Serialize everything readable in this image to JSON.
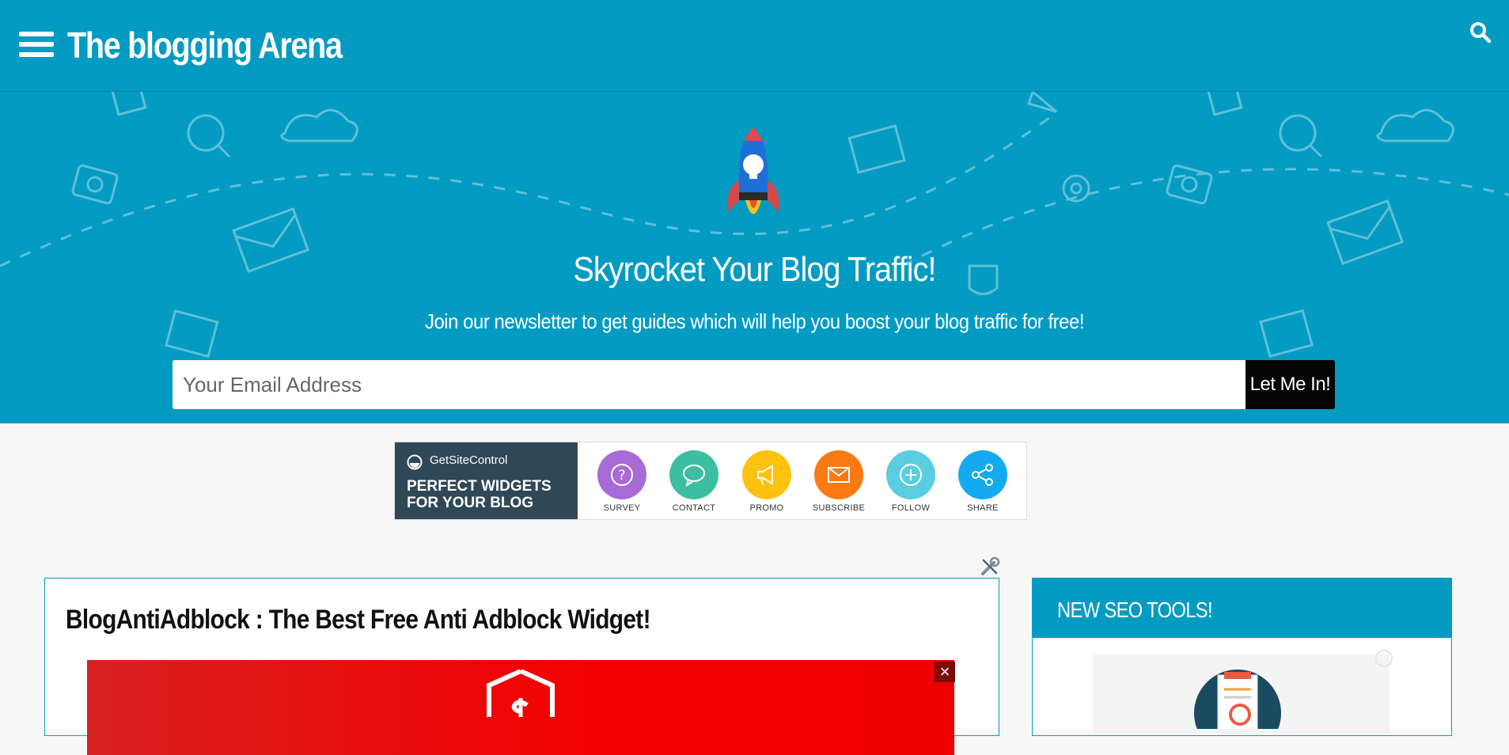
{
  "header": {
    "logo_text": "The blogging Arena",
    "menu_icon": "hamburger-icon",
    "search_icon": "search-icon",
    "background_color": "#039bc2"
  },
  "hero": {
    "title": "Skyrocket Your Blog Traffic!",
    "subtitle": "Join our newsletter to get guides which will help you boost your blog traffic for free!",
    "email_placeholder": "Your Email Address",
    "submit_label": "Let Me In!",
    "icon": "rocket-icon"
  },
  "banner": {
    "brand": "GetSiteControl",
    "headline_line1": "PERFECT WIDGETS",
    "headline_line2": "FOR YOUR BLOG",
    "widgets": [
      {
        "label": "SURVEY",
        "icon": "question-icon",
        "color": "#a86ad6"
      },
      {
        "label": "CONTACT",
        "icon": "chat-bubble-icon",
        "color": "#3cbfa0"
      },
      {
        "label": "PROMO",
        "icon": "megaphone-icon",
        "color": "#fdc110"
      },
      {
        "label": "SUBSCRIBE",
        "icon": "envelope-icon",
        "color": "#fb7a12"
      },
      {
        "label": "FOLLOW",
        "icon": "plus-icon",
        "color": "#5bcde0"
      },
      {
        "label": "SHARE",
        "icon": "share-icon",
        "color": "#13aaf1"
      }
    ]
  },
  "post": {
    "title": "BlogAntiAdblock : The Best Free Anti Adblock Widget!",
    "close_label": "×"
  },
  "sidebar": {
    "title": "NEW SEO TOOLS!"
  }
}
